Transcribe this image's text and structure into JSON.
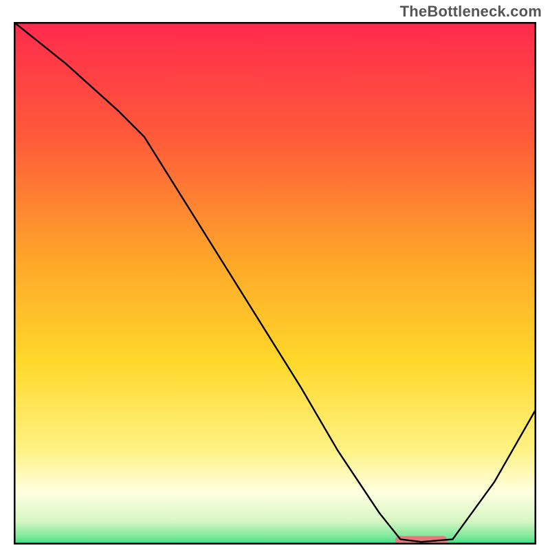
{
  "watermark": "TheBottleneck.com",
  "chart_data": {
    "type": "line",
    "title": "",
    "xlabel": "",
    "ylabel": "",
    "xlim": [
      0,
      100
    ],
    "ylim": [
      0,
      100
    ],
    "x": [
      0,
      10,
      20,
      25,
      35,
      45,
      55,
      62,
      70,
      74,
      78,
      84,
      92,
      100
    ],
    "values": [
      100,
      92,
      83,
      78,
      62,
      46,
      30,
      18,
      6,
      1,
      0.5,
      1,
      12,
      26
    ],
    "marker": {
      "x_range": [
        73,
        83
      ],
      "y": 0.7,
      "color": "#e37c7c"
    },
    "gradient_stops": [
      {
        "offset": 0.0,
        "color": "#ff2a4d"
      },
      {
        "offset": 0.22,
        "color": "#ff5a3a"
      },
      {
        "offset": 0.45,
        "color": "#ffa52a"
      },
      {
        "offset": 0.65,
        "color": "#ffd82a"
      },
      {
        "offset": 0.82,
        "color": "#fff285"
      },
      {
        "offset": 0.9,
        "color": "#ffffe0"
      },
      {
        "offset": 0.955,
        "color": "#d7f7c4"
      },
      {
        "offset": 0.985,
        "color": "#7de89a"
      },
      {
        "offset": 1.0,
        "color": "#30df80"
      }
    ],
    "frame_color": "#000000",
    "line_color": "#000000",
    "line_width": 2.4
  }
}
